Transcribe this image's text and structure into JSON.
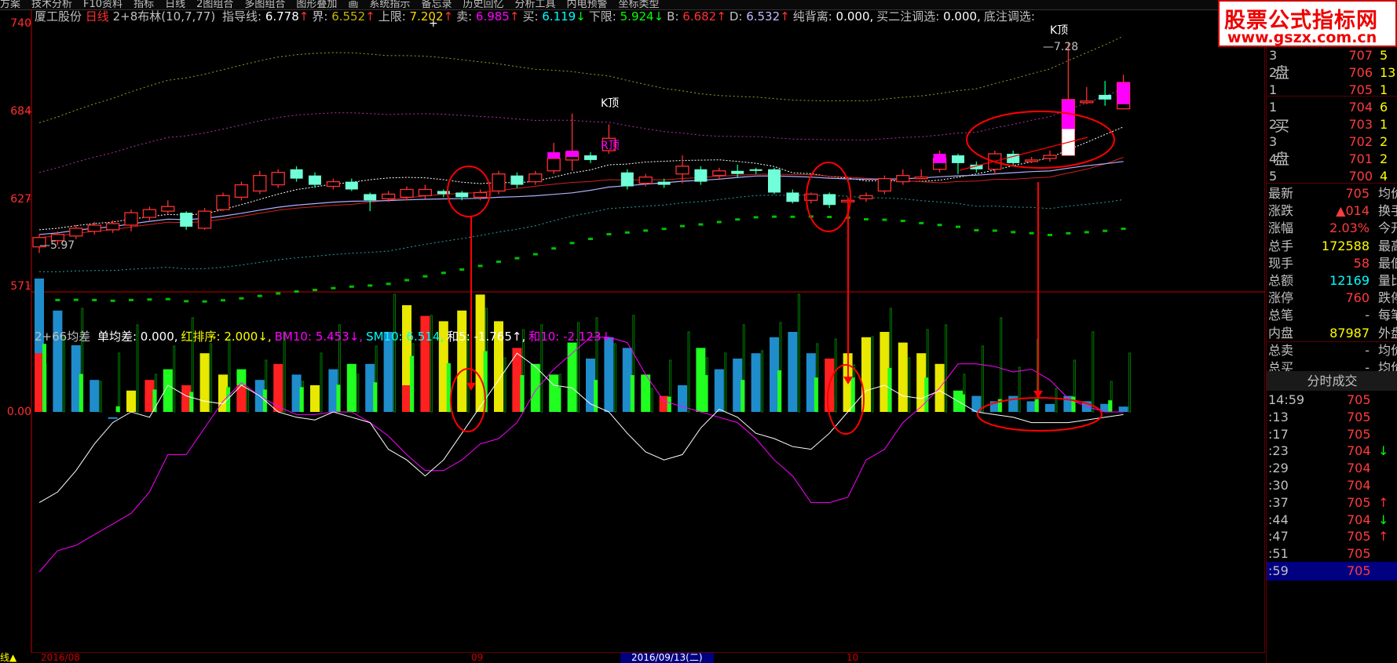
{
  "menu": [
    "方案",
    "技术分析",
    "F10资料",
    "指标",
    "日线",
    "2图组合",
    "多图组合",
    "图形叠加",
    "画",
    "系统指示",
    "备忘录",
    "历史回忆",
    "分析工具",
    "内电预警",
    "坐标类型"
  ],
  "info": {
    "stock": "厦工股份",
    "period": "日线",
    "indicator": "2+8布林(10,7,77)",
    "items": [
      {
        "label": "指导线:",
        "value": "6.778",
        "arrow": "↑",
        "color": "#ffffff"
      },
      {
        "label": "界:",
        "value": "6.552",
        "arrow": "↑",
        "color": "#c8b400"
      },
      {
        "label": "上限:",
        "value": "7.202",
        "arrow": "↑",
        "color": "#ffd700"
      },
      {
        "label": "卖:",
        "value": "6.985",
        "arrow": "↑",
        "color": "#ff00ff"
      },
      {
        "label": "买:",
        "value": "6.119",
        "arrow": "↓",
        "color": "#00ffff"
      },
      {
        "label": "下限:",
        "value": "5.924",
        "arrow": "↓",
        "color": "#00ff00"
      },
      {
        "label": "B:",
        "value": "6.682",
        "arrow": "↑",
        "color": "#ff3030"
      },
      {
        "label": "D:",
        "value": "6.532",
        "arrow": "↑",
        "color": "#c0c0ff"
      },
      {
        "label": "纯背离:",
        "value": "0.000,",
        "arrow": "",
        "color": "#ffffff"
      },
      {
        "label": "买二注调选:",
        "value": "0.000,",
        "arrow": "",
        "color": "#ffffff"
      },
      {
        "label": "底注调选:",
        "value": "",
        "arrow": "",
        "color": "#ffffff"
      }
    ]
  },
  "price_axis": [
    "740",
    "684",
    "627",
    "571"
  ],
  "osc_axis": "0.00",
  "annotations": {
    "k_top_1": "K顶",
    "r_top": "R顶",
    "k_top_2": "K顶",
    "high": "7.28",
    "low": "5.97",
    "plus": "+"
  },
  "indicator2": {
    "name": "2+66均差",
    "items": [
      {
        "label": "单均差:",
        "value": "0.000,",
        "color": "#ffffff"
      },
      {
        "label": "红排序:",
        "value": "2.000↓,",
        "color": "#ffff00"
      },
      {
        "label": "BM10:",
        "value": "5.453↓,",
        "color": "#ff00ff"
      },
      {
        "label": "SM10:",
        "value": "6.514,",
        "color": "#00ffff"
      },
      {
        "label": "和5:",
        "value": "-1.765↑,",
        "color": "#ffffff"
      },
      {
        "label": "和10:",
        "value": "-2.123↓,",
        "color": "#ff00ff"
      }
    ]
  },
  "bottom": {
    "start": "2016/08",
    "m09": "09",
    "selected_date": "2016/09/13(二)",
    "m10": "10",
    "left": "线▲"
  },
  "watermark": {
    "line1": "股票公式指标网",
    "line2": "www.gszx.com.cn"
  },
  "order_book": {
    "sell": [
      {
        "idx": "3",
        "price": "707",
        "vol": "5"
      },
      {
        "idx": "2",
        "price": "706",
        "vol": "13"
      },
      {
        "idx": "1",
        "price": "705",
        "vol": "1"
      }
    ],
    "buy": [
      {
        "idx": "1",
        "price": "704",
        "vol": "6"
      },
      {
        "idx": "2",
        "price": "703",
        "vol": "1"
      },
      {
        "idx": "3",
        "price": "702",
        "vol": "2"
      },
      {
        "idx": "4",
        "price": "701",
        "vol": "2"
      },
      {
        "idx": "5",
        "price": "700",
        "vol": "4"
      }
    ],
    "sell_word": "盘",
    "buy_word1": "买",
    "buy_word2": "盘"
  },
  "stats": [
    {
      "label": "最新",
      "value": "705",
      "label2": "均价",
      "color": "#ff3c3c"
    },
    {
      "label": "涨跌",
      "value": "▲014",
      "label2": "换手",
      "color": "#ff3c3c"
    },
    {
      "label": "涨幅",
      "value": "2.03%",
      "label2": "今开",
      "color": "#ff3c3c"
    },
    {
      "label": "总手",
      "value": "172588",
      "label2": "最高",
      "color": "#ffff00"
    },
    {
      "label": "现手",
      "value": "58",
      "label2": "最低",
      "color": "#ff3c3c"
    },
    {
      "label": "总额",
      "value": "12169",
      "label2": "量比",
      "color": "#00ffff"
    },
    {
      "label": "涨停",
      "value": "760",
      "label2": "跌停",
      "color": "#ff3c3c"
    },
    {
      "label": "总笔",
      "value": "-",
      "label2": "每笔",
      "color": "#c0c0c0"
    },
    {
      "label": "内盘",
      "value": "87987",
      "label2": "外盘",
      "color": "#ffff00"
    },
    {
      "label": "总卖",
      "value": "-",
      "label2": "均价",
      "color": "#c0c0c0"
    },
    {
      "label": "总买",
      "value": "-",
      "label2": "均价",
      "color": "#c0c0c0"
    }
  ],
  "ticks_title": "分时成交",
  "ticks": [
    {
      "time": "14:59",
      "price": "705",
      "arrow": ""
    },
    {
      "time": ":13",
      "price": "705",
      "arrow": ""
    },
    {
      "time": ":17",
      "price": "705",
      "arrow": ""
    },
    {
      "time": ":23",
      "price": "704",
      "arrow": "↓"
    },
    {
      "time": ":29",
      "price": "704",
      "arrow": ""
    },
    {
      "time": ":30",
      "price": "704",
      "arrow": ""
    },
    {
      "time": ":37",
      "price": "705",
      "arrow": "↑"
    },
    {
      "time": ":44",
      "price": "704",
      "arrow": "↓"
    },
    {
      "time": ":47",
      "price": "705",
      "arrow": "↑"
    },
    {
      "time": ":51",
      "price": "705",
      "arrow": ""
    },
    {
      "time": ":59",
      "price": "705",
      "arrow": ""
    }
  ],
  "candles": [
    [
      5.96,
      6.02,
      5.92,
      6.04
    ],
    [
      6.0,
      6.04,
      5.97,
      6.06
    ],
    [
      6.03,
      6.08,
      6.01,
      6.1
    ],
    [
      6.06,
      6.1,
      6.04,
      6.12
    ],
    [
      6.07,
      6.11,
      6.05,
      6.13
    ],
    [
      6.1,
      6.18,
      6.06,
      6.2
    ],
    [
      6.15,
      6.2,
      6.13,
      6.22
    ],
    [
      6.19,
      6.22,
      6.17,
      6.26
    ],
    [
      6.18,
      6.09,
      6.07,
      6.19
    ],
    [
      6.08,
      6.19,
      6.07,
      6.21
    ],
    [
      6.2,
      6.29,
      6.19,
      6.31
    ],
    [
      6.28,
      6.36,
      6.26,
      6.38
    ],
    [
      6.32,
      6.42,
      6.3,
      6.45
    ],
    [
      6.36,
      6.44,
      6.34,
      6.46
    ],
    [
      6.46,
      6.4,
      6.38,
      6.48
    ],
    [
      6.42,
      6.36,
      6.34,
      6.44
    ],
    [
      6.35,
      6.38,
      6.33,
      6.4
    ],
    [
      6.38,
      6.33,
      6.32,
      6.4
    ],
    [
      6.3,
      6.26,
      6.19,
      6.31
    ],
    [
      6.27,
      6.3,
      6.25,
      6.32
    ],
    [
      6.28,
      6.33,
      6.26,
      6.35
    ],
    [
      6.29,
      6.33,
      6.27,
      6.36
    ],
    [
      6.32,
      6.3,
      6.28,
      6.33
    ],
    [
      6.31,
      6.28,
      6.26,
      6.32
    ],
    [
      6.28,
      6.31,
      6.26,
      6.33
    ],
    [
      6.32,
      6.43,
      6.3,
      6.45
    ],
    [
      6.42,
      6.36,
      6.34,
      6.44
    ],
    [
      6.38,
      6.43,
      6.36,
      6.45
    ],
    [
      6.45,
      6.53,
      6.43,
      6.63
    ],
    [
      6.52,
      6.57,
      6.45,
      6.82
    ],
    [
      6.55,
      6.52,
      6.5,
      6.57
    ],
    [
      6.58,
      6.66,
      6.56,
      6.75
    ],
    [
      6.44,
      6.35,
      6.33,
      6.46
    ],
    [
      6.37,
      6.41,
      6.35,
      6.43
    ],
    [
      6.38,
      6.36,
      6.34,
      6.4
    ],
    [
      6.43,
      6.48,
      6.37,
      6.55
    ],
    [
      6.46,
      6.38,
      6.36,
      6.48
    ],
    [
      6.42,
      6.45,
      6.4,
      6.47
    ],
    [
      6.45,
      6.43,
      6.41,
      6.49
    ],
    [
      6.46,
      6.45,
      6.43,
      6.47
    ],
    [
      6.46,
      6.31,
      6.3,
      6.47
    ],
    [
      6.31,
      6.25,
      6.24,
      6.33
    ],
    [
      6.26,
      6.3,
      6.24,
      6.31
    ],
    [
      6.3,
      6.23,
      6.21,
      6.31
    ],
    [
      6.25,
      6.26,
      6.24,
      6.28
    ],
    [
      6.27,
      6.29,
      6.25,
      6.31
    ],
    [
      6.32,
      6.4,
      6.3,
      6.42
    ],
    [
      6.38,
      6.42,
      6.36,
      6.46
    ],
    [
      6.41,
      6.41,
      6.4,
      6.46
    ],
    [
      6.46,
      6.53,
      6.44,
      6.58
    ],
    [
      6.55,
      6.5,
      6.43,
      6.56
    ],
    [
      6.49,
      6.46,
      6.44,
      6.51
    ],
    [
      6.46,
      6.56,
      6.43,
      6.58
    ],
    [
      6.56,
      6.5,
      6.48,
      6.58
    ],
    [
      6.52,
      6.52,
      6.5,
      6.54
    ],
    [
      6.53,
      6.55,
      6.51,
      6.58
    ],
    [
      6.55,
      6.91,
      6.55,
      7.28
    ],
    [
      6.9,
      6.9,
      6.88,
      6.99
    ],
    [
      6.94,
      6.91,
      6.87,
      7.03
    ],
    [
      6.85,
      7.02,
      6.85,
      7.07
    ]
  ],
  "osc": [
    [
      0.5,
      0.22,
      "b"
    ],
    [
      0.38,
      0.0,
      "c"
    ],
    [
      0.25,
      0.0,
      "b"
    ],
    [
      0.12,
      0.0,
      "b"
    ],
    [
      -0.02,
      0.0,
      "b"
    ],
    [
      0.08,
      0.0,
      "y"
    ],
    [
      0.12,
      0.06,
      "r"
    ],
    [
      0.16,
      0.0,
      "g"
    ],
    [
      0.1,
      0.04,
      "r"
    ],
    [
      0.22,
      0.0,
      "y"
    ],
    [
      0.14,
      0.0,
      "y"
    ],
    [
      0.16,
      0.1,
      "g"
    ],
    [
      0.12,
      0.0,
      "b"
    ],
    [
      0.18,
      0.05,
      "r"
    ],
    [
      0.14,
      0.0,
      "b"
    ],
    [
      0.1,
      0.0,
      "y"
    ],
    [
      0.16,
      0.0,
      "b"
    ],
    [
      0.18,
      0.0,
      "g"
    ],
    [
      0.18,
      0.0,
      "b"
    ],
    [
      0.3,
      0.0,
      "b"
    ],
    [
      0.4,
      0.1,
      "y"
    ],
    [
      0.36,
      0.0,
      "r"
    ],
    [
      0.34,
      0.0,
      "y"
    ],
    [
      0.38,
      0.0,
      "y"
    ],
    [
      0.44,
      0.0,
      "y"
    ],
    [
      0.34,
      0.0,
      "y"
    ],
    [
      0.24,
      0.1,
      "r"
    ],
    [
      0.18,
      0.0,
      "g"
    ],
    [
      0.14,
      0.0,
      "g"
    ],
    [
      0.26,
      0.0,
      "g"
    ],
    [
      0.2,
      0.0,
      "b"
    ],
    [
      0.28,
      0.0,
      "b"
    ],
    [
      0.24,
      0.0,
      "b"
    ],
    [
      0.14,
      0.0,
      "g"
    ],
    [
      0.06,
      0.0,
      "r"
    ],
    [
      0.1,
      0.0,
      "b"
    ],
    [
      0.24,
      0.0,
      "g"
    ],
    [
      0.16,
      0.0,
      "b"
    ],
    [
      0.2,
      0.0,
      "b"
    ],
    [
      0.22,
      0.0,
      "b"
    ],
    [
      0.28,
      0.0,
      "b"
    ],
    [
      0.3,
      0.0,
      "b"
    ],
    [
      0.22,
      0.0,
      "b"
    ],
    [
      0.2,
      0.06,
      "r"
    ],
    [
      0.22,
      0.0,
      "y"
    ],
    [
      0.28,
      0.0,
      "y"
    ],
    [
      0.3,
      0.0,
      "y"
    ],
    [
      0.26,
      0.0,
      "y"
    ],
    [
      0.22,
      0.0,
      "y"
    ],
    [
      0.18,
      0.0,
      "y"
    ],
    [
      0.08,
      0.0,
      "g"
    ],
    [
      0.06,
      0.0,
      "b"
    ],
    [
      0.04,
      0.0,
      "b"
    ],
    [
      0.06,
      0.0,
      "b"
    ],
    [
      0.04,
      0.0,
      "b"
    ],
    [
      0.03,
      0.0,
      "b"
    ],
    [
      0.06,
      0.0,
      "b"
    ],
    [
      0.04,
      0.0,
      "b"
    ],
    [
      0.03,
      0.0,
      "b"
    ],
    [
      0.02,
      0.0,
      "b"
    ]
  ],
  "colors": {
    "up": "#ff3030",
    "down": "#00ffff",
    "magenta": "#ff00ff",
    "axis": "#ff0000",
    "annotation": "#ff0000"
  }
}
